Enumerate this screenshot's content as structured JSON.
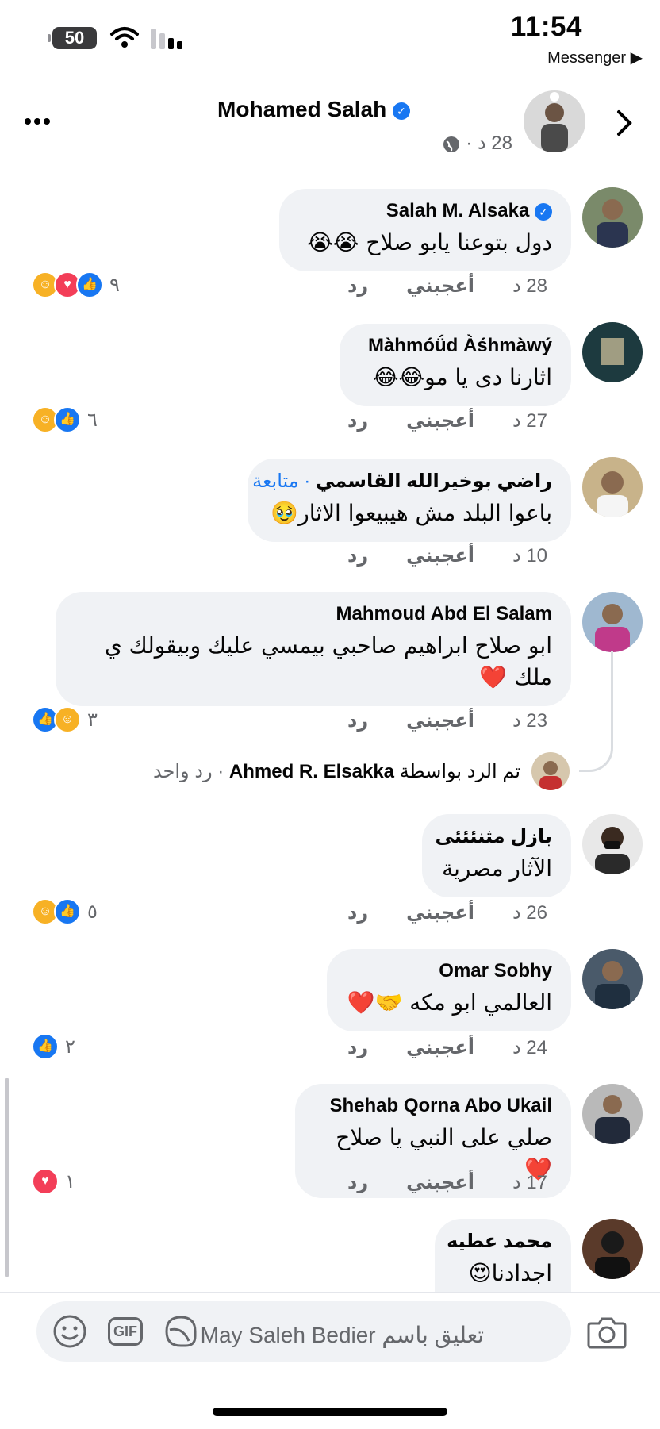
{
  "status_bar": {
    "time": "11:54",
    "back_app": "Messenger ▶",
    "battery": "50"
  },
  "post_header": {
    "author": "Mohamed Salah",
    "time": "28 د ·"
  },
  "comments": [
    {
      "author": "Salah M. Alsaka",
      "text": "دول بتوعنا يابو صلاح 😭😭",
      "age": "28 د",
      "like": "أعجبني",
      "reply": "رد",
      "reaction_count": "٩"
    },
    {
      "author": "Màhmóǘd Àśhmàwý",
      "text": "اثارنا دى يا مو😂😂",
      "age": "27 د",
      "like": "أعجبني",
      "reply": "رد",
      "reaction_count": "٦"
    },
    {
      "author": "راضي  بوخيرالله  القاسمي",
      "follow": "· متابعة",
      "text": "باعوا البلد مش هيبيعوا الاثار🥹",
      "age": "10 د",
      "like": "أعجبني",
      "reply": "رد"
    },
    {
      "author": "Mahmoud Abd El Salam",
      "text": "ابو صلاح ابراهيم صاحبي بيمسي عليك وبيقولك ي ملك ❤️",
      "age": "23 د",
      "like": "أعجبني",
      "reply": "رد",
      "reaction_count": "٣"
    },
    {
      "author": "بازل مثنئئئى",
      "text": "الآثار  مصرية",
      "age": "26 د",
      "like": "أعجبني",
      "reply": "رد",
      "reaction_count": "٥"
    },
    {
      "author": "Omar Sobhy",
      "text": "العالمي ابو مكه 🤝❤️",
      "age": "24 د",
      "like": "أعجبني",
      "reply": "رد",
      "reaction_count": "٢"
    },
    {
      "author": "Shehab Qorna Abo Ukail",
      "text": "صلي على النبي يا صلاح ❤️",
      "age": "17 د",
      "like": "أعجبني",
      "reply": "رد",
      "reaction_count": "١"
    },
    {
      "author": "محمد عطيه",
      "text": "اجدادنا😍"
    }
  ],
  "reply_summary": {
    "prefix": "تم الرد بواسطة",
    "name": "Ahmed R. Elsakka",
    "suffix": "· رد واحد"
  },
  "composer": {
    "placeholder": "تعليق باسم May Saleh Bedier",
    "gif": "GIF"
  },
  "icons": [
    "more-icon",
    "chevron-right-icon",
    "globe-icon",
    "emoji-icon",
    "gif-icon",
    "sticker-icon",
    "camera-icon"
  ],
  "colors": {
    "accent": "#1877f2",
    "bubble": "#f0f2f5",
    "secondary_text": "#65676b"
  }
}
